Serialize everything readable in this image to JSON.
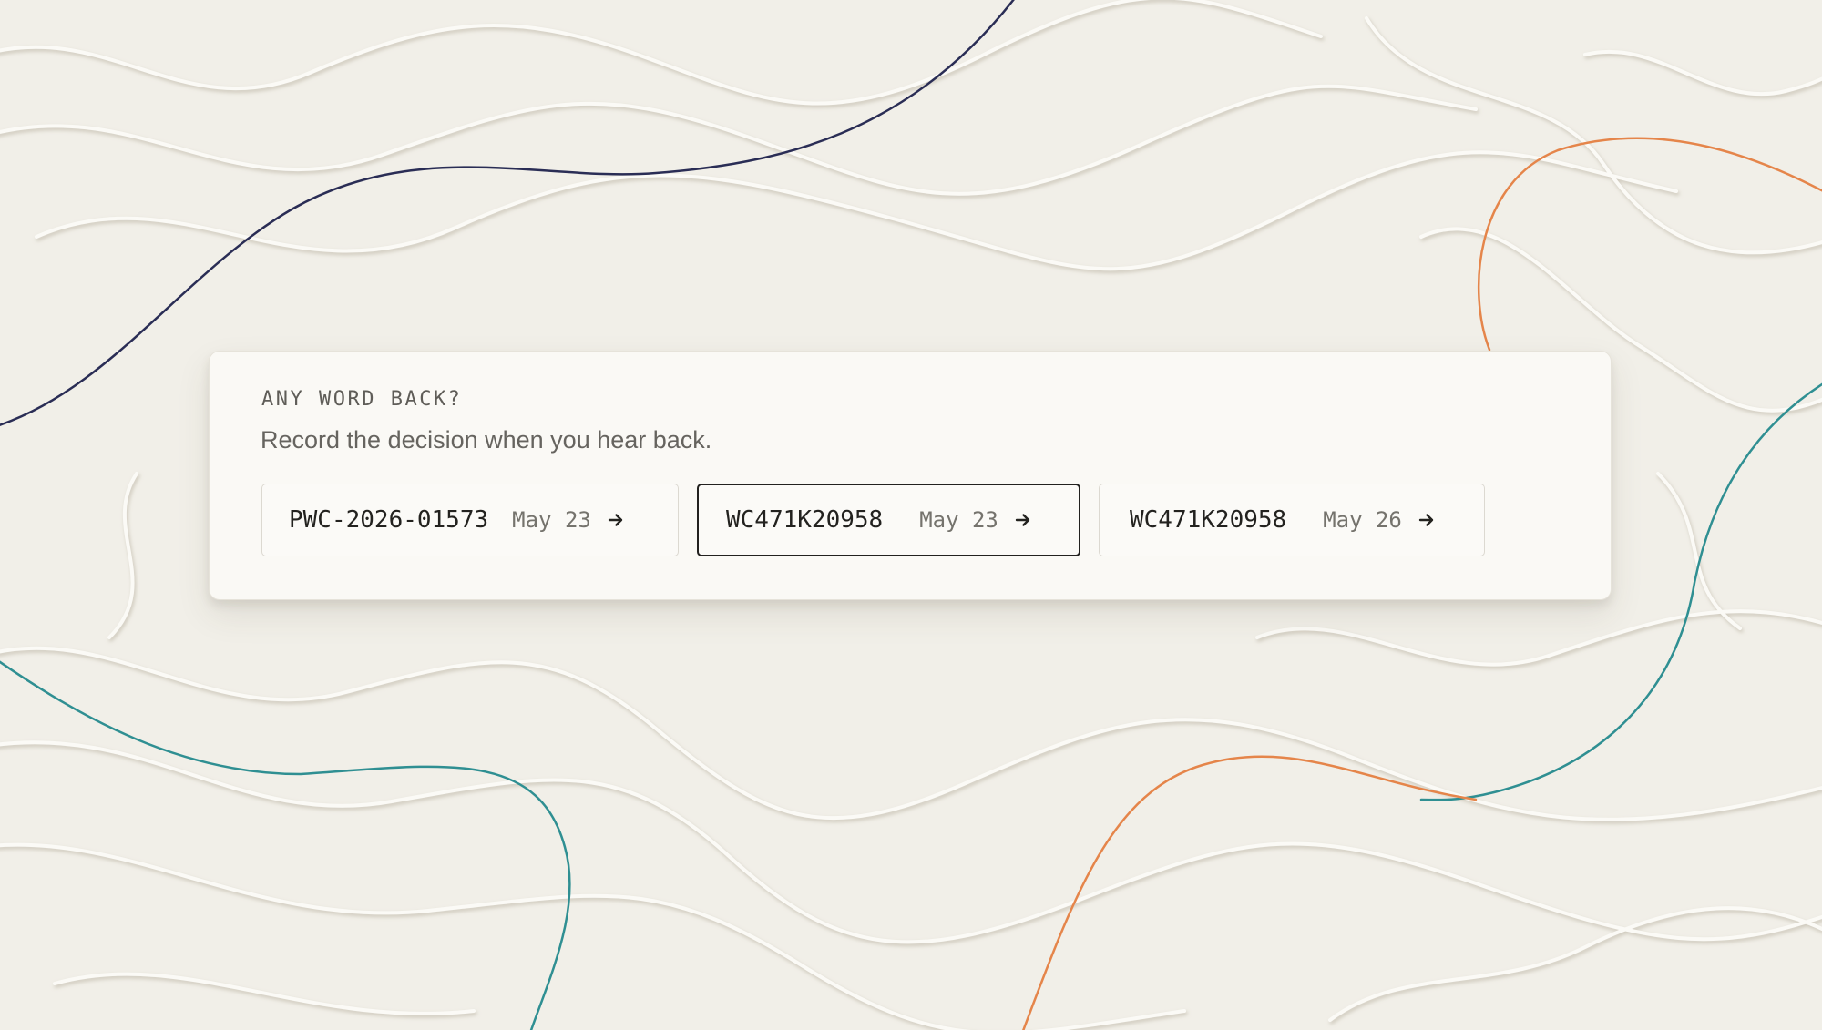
{
  "prompt": {
    "eyebrow": "ANY WORD BACK?",
    "subtitle": "Record the decision when you hear back."
  },
  "claims": [
    {
      "id": "PWC-2026-01573",
      "date": "May 23",
      "icon": "arrow-right-icon",
      "selected": false
    },
    {
      "id": "WC471K20958",
      "date": "May 23",
      "icon": "arrow-right-icon",
      "selected": true
    },
    {
      "id": "WC471K20958",
      "date": "May 26",
      "icon": "arrow-right-icon",
      "selected": false
    }
  ],
  "colors": {
    "paper": "#f1efe8",
    "card": "#faf9f5",
    "thread_navy": "#2a2d55",
    "thread_orange": "#e5854a",
    "thread_teal": "#2f8f92",
    "selected_border": "#22211f"
  }
}
